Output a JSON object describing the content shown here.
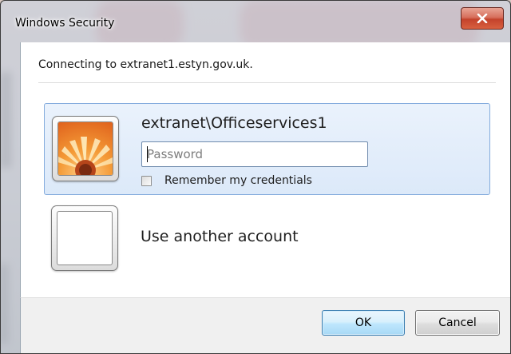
{
  "window": {
    "title": "Windows Security",
    "close_symbol": "x"
  },
  "message": "Connecting to extranet1.estyn.gov.uk.",
  "accounts": [
    {
      "username": "extranet\\Officeservices1",
      "password_placeholder": "Password",
      "password_value": "",
      "remember_label": "Remember my credentials",
      "remember_checked": false,
      "selected": true,
      "avatar_icon": "orange-flower-icon"
    },
    {
      "label": "Use another account",
      "avatar_icon": "blank-user-tile-icon"
    }
  ],
  "buttons": {
    "ok_label": "OK",
    "cancel_label": "Cancel"
  },
  "colors": {
    "selected_tile_border": "#84acdd",
    "selected_tile_fill": "#dce9f9",
    "ok_button_border": "#3c7fb1",
    "close_button_red": "#c4432c"
  }
}
